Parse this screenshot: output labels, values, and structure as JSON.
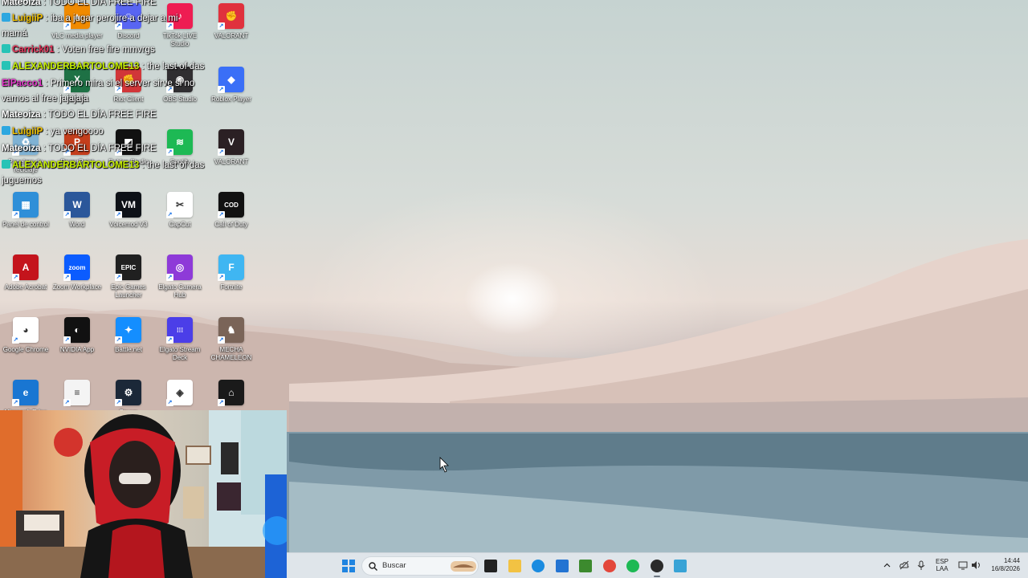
{
  "desktop": {
    "icons": [
      {
        "id": "vlc",
        "label": "VLC media player",
        "color": "#f08a00",
        "glyph": "▲"
      },
      {
        "id": "discord",
        "label": "Discord",
        "color": "#5865f2",
        "glyph": "☺"
      },
      {
        "id": "tiktok",
        "label": "TikTok LIVE Studio",
        "color": "#ee1d52",
        "glyph": "♪"
      },
      {
        "id": "valorant1",
        "label": "VALORANT",
        "color": "#e0313d",
        "glyph": "✊"
      },
      {
        "id": "excel",
        "label": "Excel",
        "color": "#1e7145",
        "glyph": "X"
      },
      {
        "id": "riot",
        "label": "Riot Client",
        "color": "#d13639",
        "glyph": "✊"
      },
      {
        "id": "obs",
        "label": "OBS Studio",
        "color": "#302e31",
        "glyph": "◉"
      },
      {
        "id": "roblox-player",
        "label": "Roblox Player",
        "color": "#3a6ff7",
        "glyph": "◆"
      },
      {
        "id": "recycle",
        "label": "Papelera de reciclaje",
        "color": "#7fb2d4",
        "glyph": "♻"
      },
      {
        "id": "powerpoint",
        "label": "PowerPoint",
        "color": "#c43e1c",
        "glyph": "P"
      },
      {
        "id": "roblox-studio",
        "label": "Roblox Studio",
        "color": "#111111",
        "glyph": "◩"
      },
      {
        "id": "spotify",
        "label": "Spotify",
        "color": "#1db954",
        "glyph": "≋"
      },
      {
        "id": "valorant2",
        "label": "VALORANT",
        "color": "#2b2024",
        "glyph": "V"
      },
      {
        "id": "panel",
        "label": "Panel de control",
        "color": "#2f8fd8",
        "glyph": "▦"
      },
      {
        "id": "word",
        "label": "Word",
        "color": "#2b579a",
        "glyph": "W"
      },
      {
        "id": "voicemod",
        "label": "Voicemod V3",
        "color": "#0d1117",
        "glyph": "VM"
      },
      {
        "id": "capcut",
        "label": "CapCut",
        "color": "#ffffff",
        "glyph": "✂"
      },
      {
        "id": "cod",
        "label": "Call of Duty",
        "color": "#111111",
        "glyph": "COD"
      },
      {
        "id": "acrobat",
        "label": "Adobe Acrobat",
        "color": "#c4141c",
        "glyph": "A"
      },
      {
        "id": "zoom",
        "label": "Zoom Workplace",
        "color": "#0b5cff",
        "glyph": "zoom"
      },
      {
        "id": "epic",
        "label": "Epic Games Launcher",
        "color": "#202020",
        "glyph": "EPIC"
      },
      {
        "id": "elgato-hub",
        "label": "Elgato Camera Hub",
        "color": "#8e3ad8",
        "glyph": "◎"
      },
      {
        "id": "fortnite",
        "label": "Fortnite",
        "color": "#3fb6f2",
        "glyph": "F"
      },
      {
        "id": "chrome",
        "label": "Google Chrome",
        "color": "#ffffff",
        "glyph": "◕"
      },
      {
        "id": "nvidia",
        "label": "NVIDIA App",
        "color": "#111111",
        "glyph": "◐"
      },
      {
        "id": "battlenet",
        "label": "Battle.net",
        "color": "#148eff",
        "glyph": "✦"
      },
      {
        "id": "streamdeck",
        "label": "Elgato Stream Deck",
        "color": "#4b3ee8",
        "glyph": "⁞⁞⁞"
      },
      {
        "id": "mecha",
        "label": "MECHA CHAMELEON",
        "color": "#7a6458",
        "glyph": "♞"
      },
      {
        "id": "edge",
        "label": "Microsoft Edge",
        "color": "#1976d2",
        "glyph": "e"
      },
      {
        "id": "file",
        "label": "",
        "color": "#f4f4f4",
        "glyph": "≡"
      },
      {
        "id": "steam",
        "label": "Steam",
        "color": "#1b2838",
        "glyph": "⚙"
      },
      {
        "id": "app-blue",
        "label": "",
        "color": "#ffffff",
        "glyph": "◈"
      },
      {
        "id": "app-dark",
        "label": "",
        "color": "#1a1a1a",
        "glyph": "⌂"
      }
    ]
  },
  "chat": {
    "messages": [
      {
        "id": "m0",
        "user": "Mateoiza",
        "user_color": "#ffffff",
        "badge": "",
        "text": " : TODO EL DÍA FREE FIRE"
      },
      {
        "id": "m1",
        "user": "LuigiiP",
        "user_color": "#f4c300",
        "badge": "#2da7e0",
        "text": " : iba a jugar perojire a dejar a mi"
      },
      {
        "id": "m1b",
        "user": "",
        "user_color": "#ffffff",
        "badge": "",
        "text": "mamá"
      },
      {
        "id": "m2",
        "user": "Carrick01",
        "user_color": "#e8335a",
        "badge": "#27c3b6",
        "text": " : Voten free fire mmvrgs"
      },
      {
        "id": "m3",
        "user": "ALEXANDERBARTOLOME13",
        "user_color": "#c7f000",
        "badge": "#27c3b6",
        "text": " : the last of das"
      },
      {
        "id": "m4",
        "user": "ElPacco1",
        "user_color": "#e236c9",
        "badge": "",
        "text": " : Primero mira si el server sirve si no"
      },
      {
        "id": "m4b",
        "user": "",
        "user_color": "#ffffff",
        "badge": "",
        "text": "vamos al free jajajaja"
      },
      {
        "id": "m5",
        "user": "Mateoiza",
        "user_color": "#ffffff",
        "badge": "",
        "text": " : TODO EL DÍA FREE FIRE"
      },
      {
        "id": "m6",
        "user": "LuigiiP",
        "user_color": "#f4c300",
        "badge": "#2da7e0",
        "text": " : ya vengoooo"
      },
      {
        "id": "m7",
        "user": "Mateoiza",
        "user_color": "#ffffff",
        "badge": "",
        "text": " : TODO EL DÍA FREE FIRE"
      },
      {
        "id": "m8",
        "user": "ALEXANDERBARTOLOME13",
        "user_color": "#c7f000",
        "badge": "#27c3b6",
        "text": " : the last of das"
      },
      {
        "id": "m8b",
        "user": "",
        "user_color": "#ffffff",
        "badge": "",
        "text": "juguemos"
      }
    ]
  },
  "taskbar": {
    "search_placeholder": "Buscar",
    "pinned": [
      {
        "id": "start",
        "icon": "windows-icon",
        "color": "#1f84e0"
      },
      {
        "id": "taskview",
        "icon": "task-view-icon",
        "color": "#222222"
      },
      {
        "id": "explorer",
        "icon": "folder-icon",
        "color": "#f2c243"
      },
      {
        "id": "edge",
        "icon": "edge-icon",
        "color": "#1a8be0"
      },
      {
        "id": "store",
        "icon": "store-icon",
        "color": "#2374d2"
      },
      {
        "id": "minecraft",
        "icon": "minecraft-icon",
        "color": "#3c8a2e"
      },
      {
        "id": "chrome",
        "icon": "chrome-icon",
        "color": "#e3473b"
      },
      {
        "id": "spotify",
        "icon": "spotify-icon",
        "color": "#1db954"
      },
      {
        "id": "obs",
        "icon": "obs-icon",
        "color": "#2a2a2a"
      },
      {
        "id": "notepad",
        "icon": "notepad-icon",
        "color": "#38a3d6"
      }
    ],
    "tray": {
      "language": "ESP",
      "layout": "LAA",
      "time": "14:44",
      "date": "16/8/2026"
    }
  }
}
